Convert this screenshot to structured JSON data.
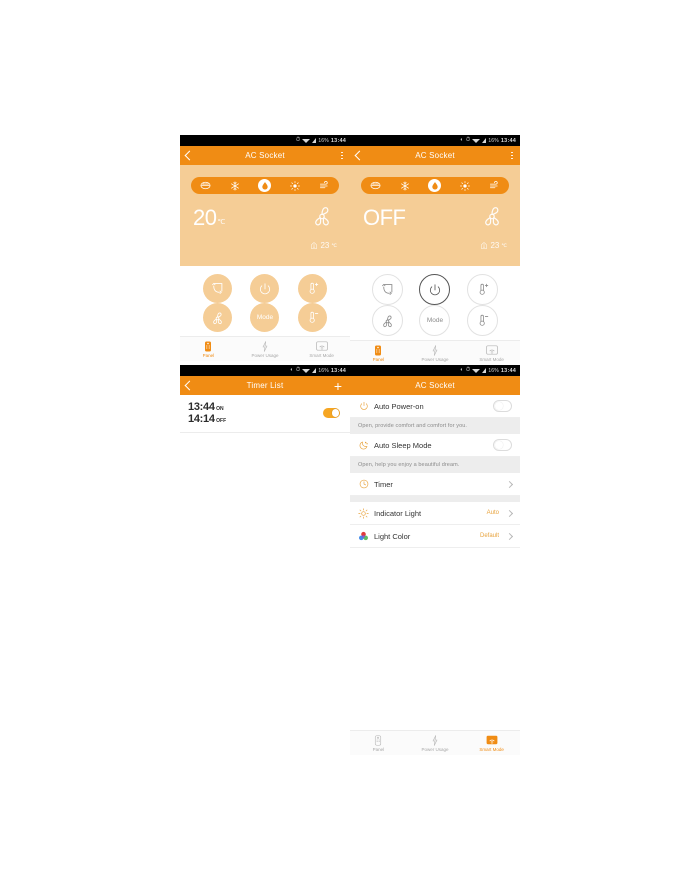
{
  "statusbar": {
    "battery": "16%",
    "time": "13:44"
  },
  "panels": {
    "panel_left": {
      "title": "AC Socket",
      "modes": [
        {
          "name": "auto",
          "label": "Auto",
          "selected": false
        },
        {
          "name": "cool",
          "label": "Cool",
          "selected": false
        },
        {
          "name": "dry",
          "label": "Dry",
          "selected": true
        },
        {
          "name": "heat",
          "label": "Heat",
          "selected": false
        },
        {
          "name": "wind",
          "label": "Fan",
          "selected": false
        }
      ],
      "temperature": "20",
      "temperature_unit": "℃",
      "indoor_temperature": "23",
      "indoor_unit": "℃",
      "buttons": [
        {
          "name": "swing",
          "label": ""
        },
        {
          "name": "power",
          "label": ""
        },
        {
          "name": "temp-up",
          "label": ""
        },
        {
          "name": "fan-speed",
          "label": ""
        },
        {
          "name": "mode",
          "label": "Mode"
        },
        {
          "name": "temp-down",
          "label": ""
        }
      ]
    },
    "panel_right": {
      "title": "AC Socket",
      "power_state": "OFF",
      "indoor_temperature": "23",
      "indoor_unit": "℃",
      "mode_label": "Mode"
    },
    "timer_list": {
      "title": "Timer List",
      "add_label": "+",
      "rows": [
        {
          "on_time": "13:44",
          "on_suffix": "ON",
          "off_time": "14:14",
          "off_suffix": "OFF",
          "enabled": true
        }
      ]
    },
    "smart_mode": {
      "title": "AC Socket",
      "items": [
        {
          "type": "toggle",
          "icon": "power-icon",
          "label": "Auto Power-on",
          "enabled": false,
          "description": "Open, provide comfort and comfort for you."
        },
        {
          "type": "toggle",
          "icon": "moon-icon",
          "label": "Auto Sleep Mode",
          "enabled": false,
          "description": "Open, help you enjoy a beautiful dream."
        },
        {
          "type": "link",
          "icon": "clock-icon",
          "label": "Timer",
          "value": ""
        },
        {
          "type": "link",
          "icon": "sun-icon",
          "label": "Indicator Light",
          "value": "Auto"
        },
        {
          "type": "link",
          "icon": "color-wheel-icon",
          "label": "Light Color",
          "value": "Default"
        }
      ]
    }
  },
  "bottom_nav": {
    "items": [
      {
        "name": "panel",
        "label": "Panel"
      },
      {
        "name": "power-usage",
        "label": "Power Usage"
      },
      {
        "name": "smart-mode",
        "label": "Smart Mode"
      }
    ]
  },
  "colors": {
    "accent": "#F08C14",
    "peach": "#F5CD96",
    "toggle_on": "#F6A623",
    "value_text": "#E8A33D"
  }
}
